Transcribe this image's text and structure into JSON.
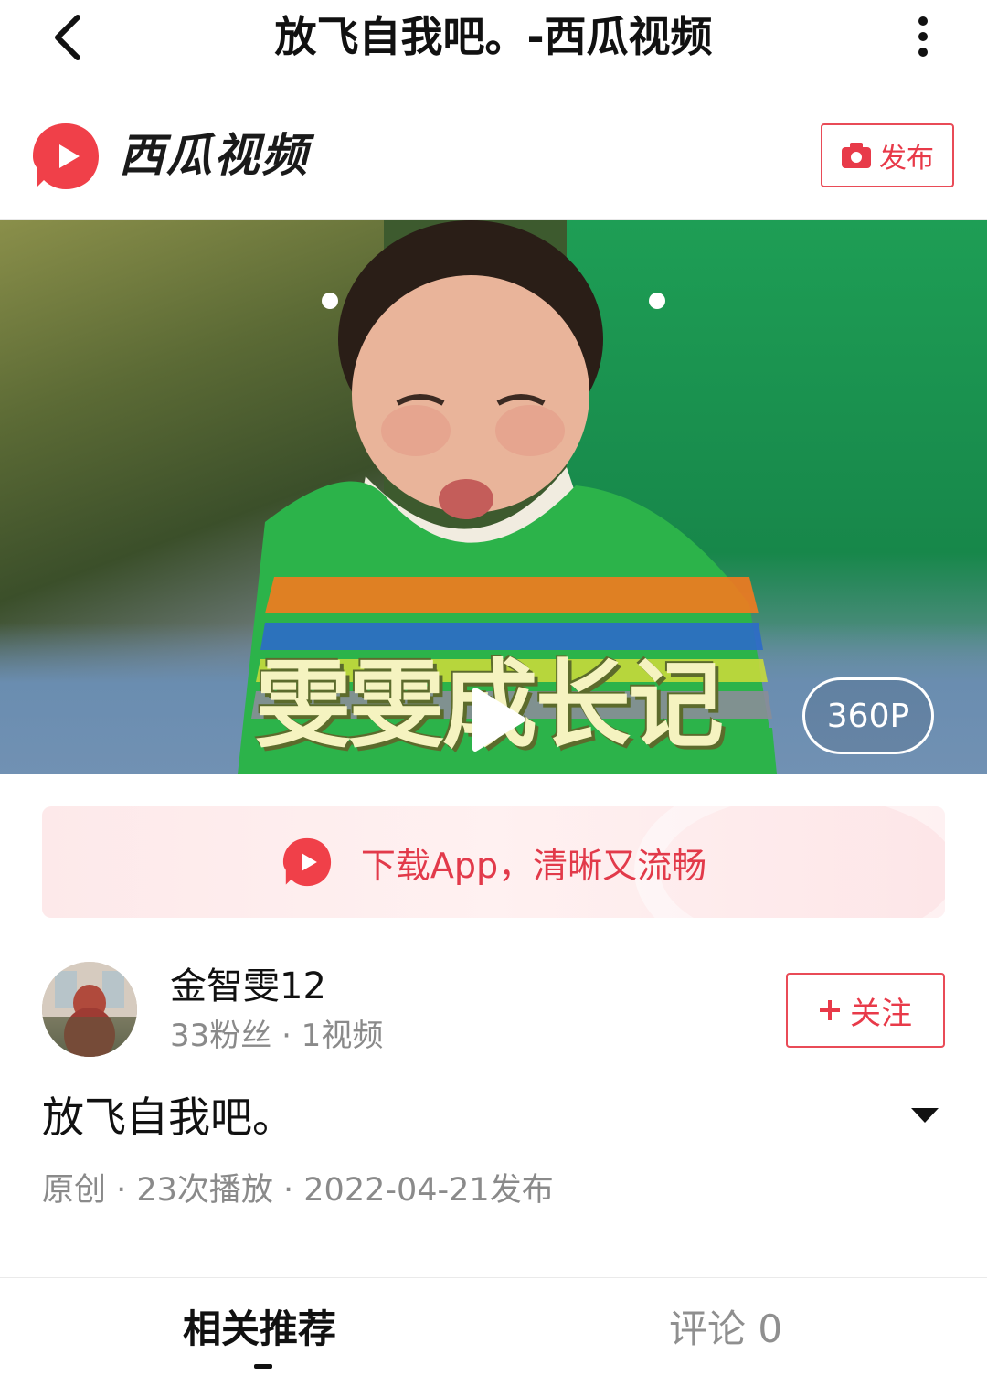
{
  "topbar": {
    "back_icon": "chevron-left-icon",
    "title": "放飞自我吧。-西瓜视频",
    "more_icon": "vertical-dots-icon"
  },
  "brand": {
    "name": "西瓜视频",
    "logo_icon": "xigua-logo-icon",
    "publish_label": "发布",
    "publish_icon": "camera-icon",
    "accent_color": "#e83a49"
  },
  "video": {
    "caption": "雯雯成长记",
    "quality_label": "360P",
    "play_icon": "play-icon"
  },
  "download_banner": {
    "text": "下载App，清晰又流畅",
    "icon": "xigua-logo-icon"
  },
  "author": {
    "name": "金智雯12",
    "stats": "33粉丝 · 1视频",
    "follow_label": "关注",
    "follow_icon": "plus-icon"
  },
  "video_info": {
    "title": "放飞自我吧。",
    "meta": "原创 · 23次播放 · 2022-04-21发布",
    "expand_icon": "caret-down-icon"
  },
  "tabs": {
    "related_label": "相关推荐",
    "comments_label": "评论 0"
  }
}
